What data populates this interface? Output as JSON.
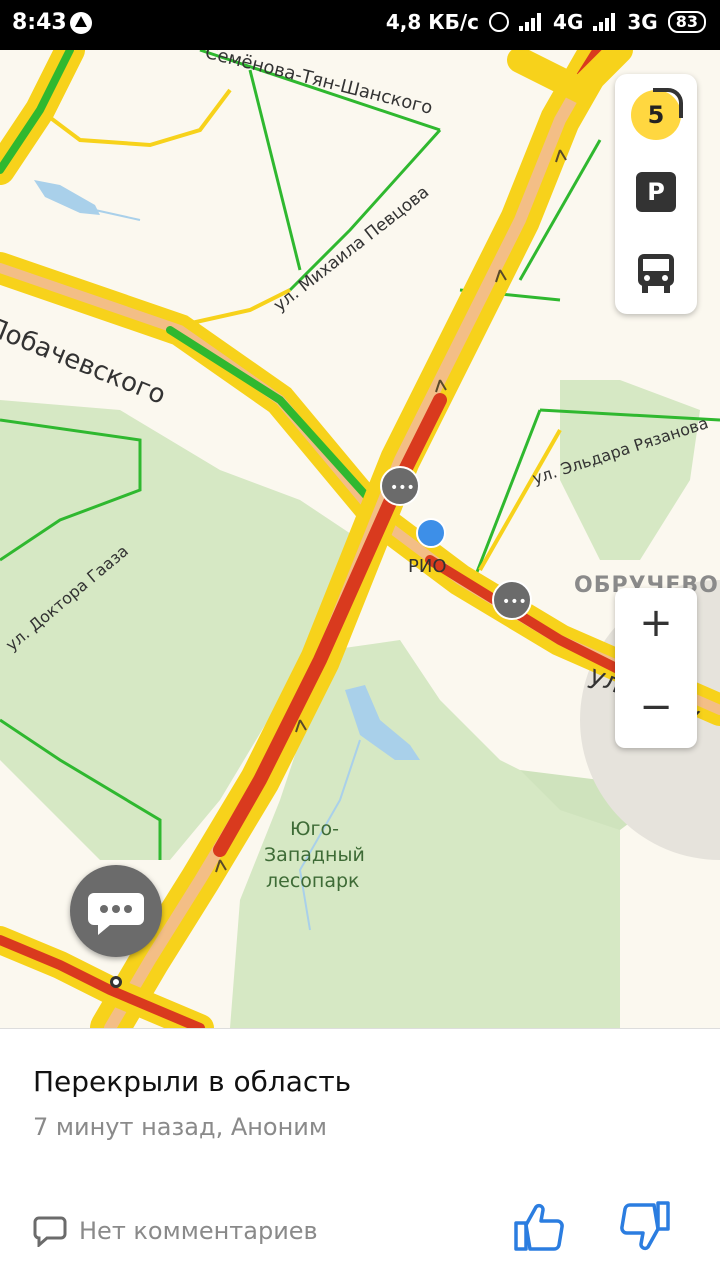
{
  "status_bar": {
    "time": "8:43",
    "network_speed": "4,8 КБ/с",
    "network_4g": "4G",
    "network_3g": "3G",
    "battery": "83"
  },
  "map": {
    "labels": {
      "lobachevskogo": "Лобачевского",
      "semenova": "Семёнова-Тян-Шанского",
      "pevtsova": "ул. Михаила Певцова",
      "ryazanova": "ул. Эльдара Рязанова",
      "gaaza": "ул. Доктора Гааза",
      "obrucheva_street": "ул. Обру",
      "district": "ОБРУЧЕВО",
      "rio": "РИО",
      "park_line1": "Юго-",
      "park_line2": "Западный",
      "park_line3": "лесопарк"
    },
    "traffic_level": "5",
    "parking_label": "P"
  },
  "zoom": {
    "in": "+",
    "out": "−"
  },
  "event_card": {
    "title": "Перекрыли в область",
    "meta": "7 минут назад, Аноним",
    "comments": "Нет комментариев"
  },
  "colors": {
    "traffic_red": "#d93a1e",
    "traffic_yellow": "#f7d21b",
    "traffic_green": "#2fb82f",
    "park": "#d6e8c4",
    "accent_blue": "#2b7de0"
  }
}
